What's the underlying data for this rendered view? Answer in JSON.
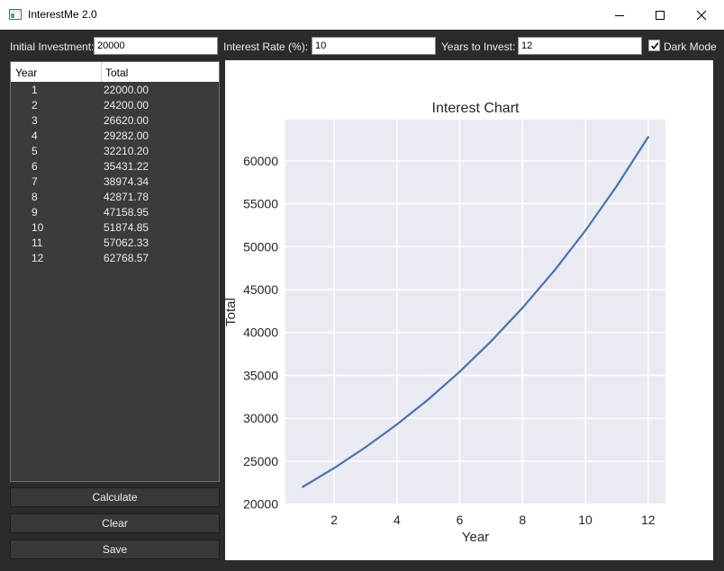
{
  "window": {
    "title": "InterestMe 2.0"
  },
  "inputs": {
    "initial_label": "Initial Investment:",
    "initial_value": "20000",
    "rate_label": "Interest Rate (%):",
    "rate_value": "10",
    "years_label": "Years to Invest:",
    "years_value": "12",
    "dark_mode_label": "Dark Mode",
    "dark_mode_checked": true
  },
  "table": {
    "headers": [
      "Year",
      "Total"
    ],
    "rows": [
      [
        "1",
        "22000.00"
      ],
      [
        "2",
        "24200.00"
      ],
      [
        "3",
        "26620.00"
      ],
      [
        "4",
        "29282.00"
      ],
      [
        "5",
        "32210.20"
      ],
      [
        "6",
        "35431.22"
      ],
      [
        "7",
        "38974.34"
      ],
      [
        "8",
        "42871.78"
      ],
      [
        "9",
        "47158.95"
      ],
      [
        "10",
        "51874.85"
      ],
      [
        "11",
        "57062.33"
      ],
      [
        "12",
        "62768.57"
      ]
    ]
  },
  "buttons": {
    "calculate": "Calculate",
    "clear": "Clear",
    "save": "Save"
  },
  "chart_data": {
    "type": "line",
    "title": "Interest Chart",
    "xlabel": "Year",
    "ylabel": "Total",
    "x": [
      1,
      2,
      3,
      4,
      5,
      6,
      7,
      8,
      9,
      10,
      11,
      12
    ],
    "series": [
      {
        "values": [
          22000.0,
          24200.0,
          26620.0,
          29282.0,
          32210.2,
          35431.22,
          38974.34,
          42871.78,
          47158.95,
          51874.85,
          57062.33,
          62768.57
        ],
        "color": "#4c72b0"
      }
    ],
    "xticks": [
      2,
      4,
      6,
      8,
      10,
      12
    ],
    "yticks": [
      20000,
      25000,
      30000,
      35000,
      40000,
      45000,
      50000,
      55000,
      60000
    ],
    "xlim": [
      0.45,
      12.55
    ],
    "ylim": [
      19960,
      64800
    ],
    "grid": true,
    "plot_bg": "#eaeaf2"
  }
}
